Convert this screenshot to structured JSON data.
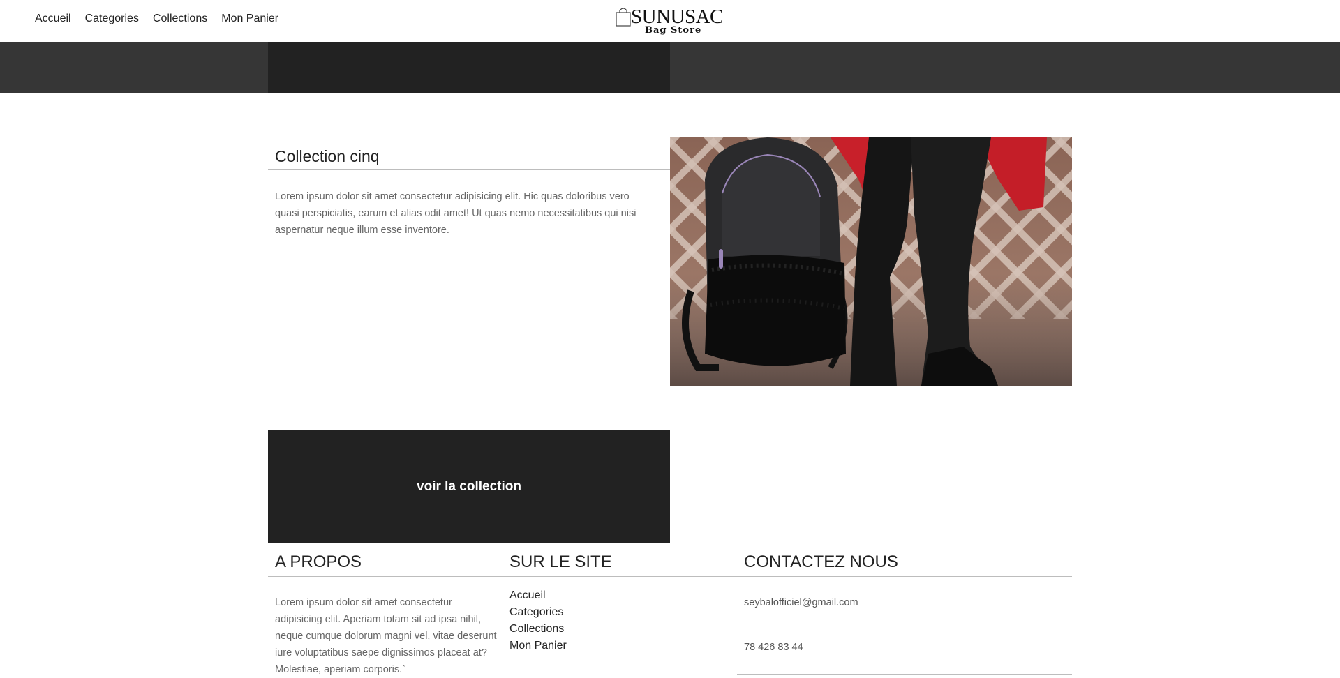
{
  "nav": {
    "items": [
      {
        "label": "Accueil"
      },
      {
        "label": "Categories"
      },
      {
        "label": "Collections"
      },
      {
        "label": "Mon Panier"
      }
    ]
  },
  "logo": {
    "title": "SUNUSAC",
    "subtitle": "Bag Store",
    "icon": "shopping-bag-icon"
  },
  "collection": {
    "title": "Collection cinq",
    "description": "Lorem ipsum dolor sit amet consectetur adipisicing elit. Hic quas doloribus vero quasi perspiciatis, earum et alias odit amet! Ut quas nemo necessitatibus qui nisi aspernatur neque illum esse inventore.",
    "image_subject": "black leather backpack with fur, person in black jeans and red coat"
  },
  "cta": {
    "label": "voir la collection"
  },
  "footer": {
    "about": {
      "heading": "A PROPOS",
      "text": "Lorem ipsum dolor sit amet consectetur adipisicing elit. Aperiam totam sit ad ipsa nihil, neque cumque dolorum magni vel, vitae deserunt iure voluptatibus saepe dignissimos placeat at? Molestiae, aperiam corporis.`"
    },
    "site": {
      "heading": "SUR LE SITE",
      "links": [
        {
          "label": "Accueil"
        },
        {
          "label": "Categories"
        },
        {
          "label": "Collections"
        },
        {
          "label": "Mon Panier"
        }
      ]
    },
    "contact": {
      "heading": "CONTACTEZ NOUS",
      "email": "seybalofficiel@gmail.com",
      "phone": "78 426 83 44"
    }
  },
  "colors": {
    "band": "#363636",
    "dark_block": "#222222",
    "divider": "#bdbdbd",
    "text": "#222222",
    "muted_text": "#666666"
  }
}
